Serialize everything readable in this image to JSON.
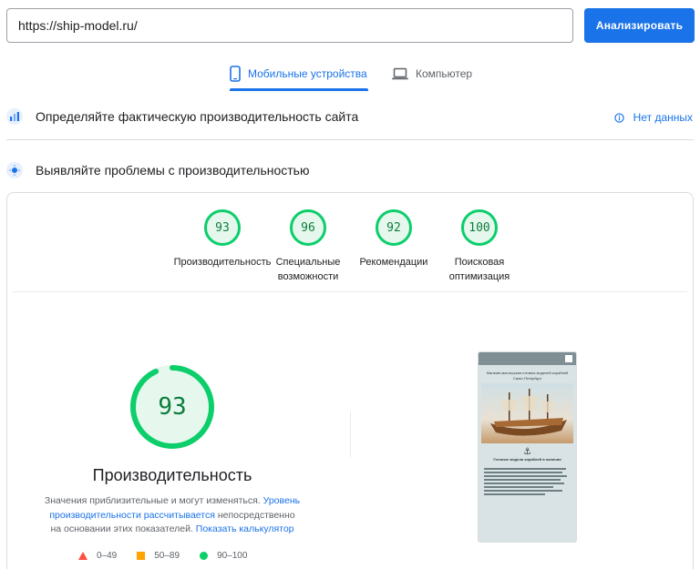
{
  "search": {
    "url": "https://ship-model.ru/"
  },
  "analyze_label": "Анализировать",
  "tabs": [
    {
      "label": "Мобильные устройства",
      "icon": "phone-icon",
      "active": true
    },
    {
      "label": "Компьютер",
      "icon": "laptop-icon",
      "active": false
    }
  ],
  "field_data": {
    "title": "Определяйте фактическую производительность сайта",
    "status": "Нет данных",
    "icon": "chart-icon",
    "status_icon": "info-icon"
  },
  "lab_data": {
    "title": "Выявляйте проблемы с производительностью",
    "icon": "lighthouse-icon"
  },
  "scores": [
    {
      "value": "93",
      "label": "Производительность"
    },
    {
      "value": "96",
      "label": "Специальные возможности"
    },
    {
      "value": "92",
      "label": "Рекомендации"
    },
    {
      "value": "100",
      "label": "Поисковая оптимизация"
    }
  ],
  "performance": {
    "score": "93",
    "score_fraction": 0.93,
    "title": "Производительность",
    "desc_pre": "Значения приблизительные и могут изменяться. ",
    "desc_link1": "Уровень производительности рассчитывается",
    "desc_mid": " непосредственно на основании этих показателей. ",
    "desc_link2": "Показать калькулятор"
  },
  "legend": [
    {
      "range": "0–49",
      "color": "#ff4e42"
    },
    {
      "range": "50–89",
      "color": "#ffa400"
    },
    {
      "range": "90–100",
      "color": "#0cce6b"
    }
  ],
  "preview": {
    "hero": "Магазин-мастерская готовых моделей кораблей Санкт-Петербург",
    "subtitle": "Готовые модели кораблей в наличии"
  },
  "colors": {
    "accent": "#1a73e8",
    "pass": "#0cce6b",
    "pass_text": "#0c7d3c"
  }
}
